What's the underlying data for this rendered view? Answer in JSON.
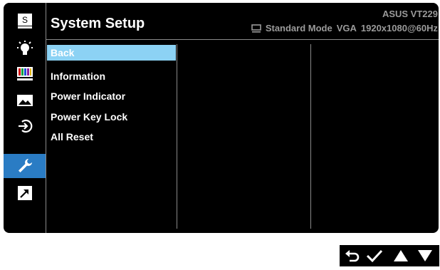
{
  "osd": {
    "title": "System Setup",
    "model": "ASUS VT229",
    "status": {
      "mode": "Standard Mode",
      "input": "VGA",
      "resolution": "1920x1080@60Hz",
      "icon": "monitor-icon"
    }
  },
  "sidebar": {
    "items": [
      {
        "icon": "splendid-icon",
        "label": "S"
      },
      {
        "icon": "brightness-bulb-icon"
      },
      {
        "icon": "color-bars-icon"
      },
      {
        "icon": "image-landscape-icon"
      },
      {
        "icon": "input-select-icon"
      },
      {
        "icon": "wrench-icon",
        "active": true
      },
      {
        "icon": "shortcut-arrow-icon"
      }
    ]
  },
  "menu": {
    "items": [
      {
        "label": "Back",
        "selected": true
      },
      {
        "label": "Information"
      },
      {
        "label": "Power Indicator"
      },
      {
        "label": "Power Key Lock"
      },
      {
        "label": "All Reset"
      }
    ]
  },
  "controls": [
    {
      "icon": "back-arrow-icon"
    },
    {
      "icon": "checkmark-icon"
    },
    {
      "icon": "up-triangle-icon"
    },
    {
      "icon": "down-triangle-icon"
    }
  ],
  "colors": {
    "panel": "#000000",
    "active_sidebar": "#2a7cc4",
    "selected_row": "#8cd2f4",
    "divider": "#8a8a8a",
    "status_text": "#9a9a9a"
  }
}
